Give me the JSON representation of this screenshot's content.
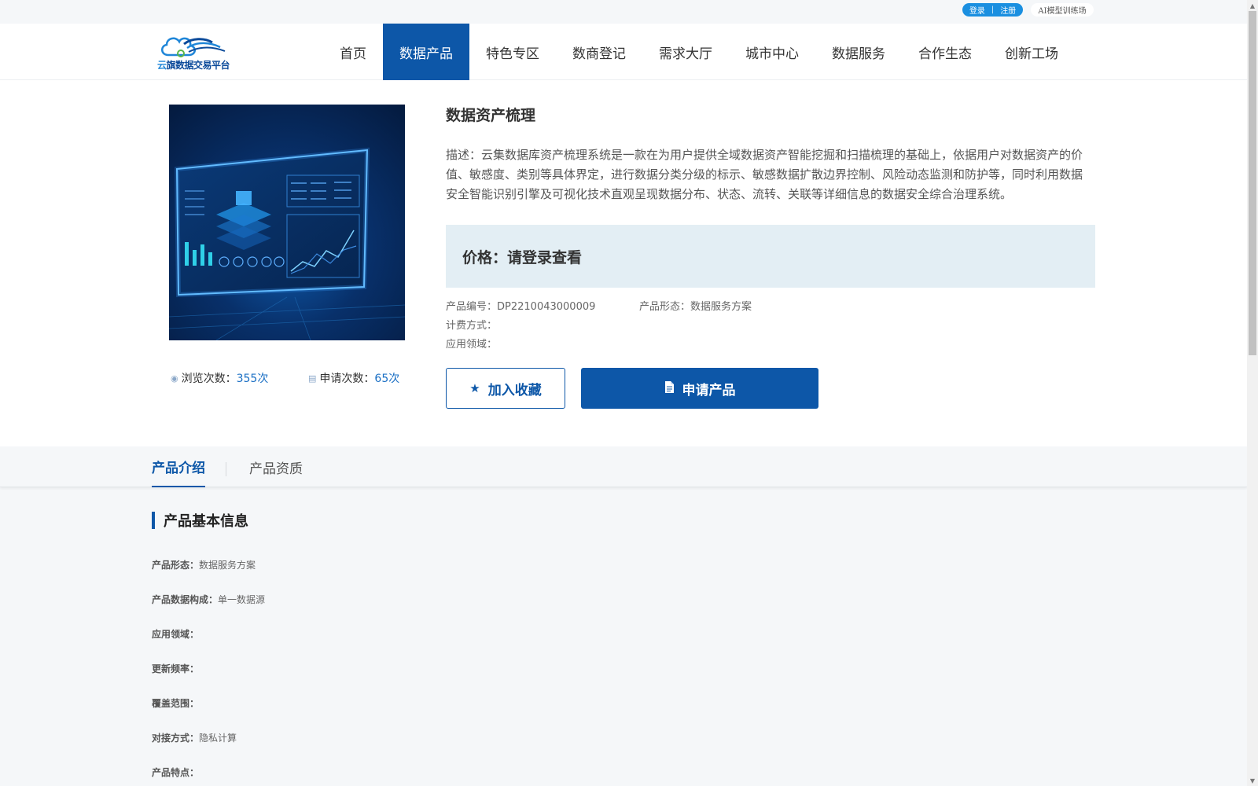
{
  "topbar": {
    "login": "登录",
    "separator": "|",
    "register": "注册",
    "ai_training": "AI模型训练场"
  },
  "logo": {
    "text_prefix": "云",
    "text_rest": "旗数据交易平台"
  },
  "nav": {
    "items": [
      "首页",
      "数据产品",
      "特色专区",
      "数商登记",
      "需求大厅",
      "城市中心",
      "数据服务",
      "合作生态",
      "创新工场"
    ],
    "active_index": 1
  },
  "product": {
    "title": "数据资产梳理",
    "description": "描述：云集数据库资产梳理系统是一款在为用户提供全域数据资产智能挖掘和扫描梳理的基础上，依据用户对数据资产的价值、敏感度、类别等具体界定，进行数据分类分级的标示、敏感数据扩散边界控制、风险动态监测和防护等，同时利用数据安全智能识别引擎及可视化技术直观呈现数据分布、状态、流转、关联等详细信息的数据安全综合治理系统。",
    "price_label": "价格：请登录查看",
    "code_label": "产品编号：",
    "code_value": "DP2210043000009",
    "form_label": "产品形态：",
    "form_value": "数据服务方案",
    "billing_label": "计费方式：",
    "billing_value": "",
    "domain_label": "应用领域：",
    "domain_value": "",
    "views_label": "浏览次数：",
    "views_value": "355次",
    "applies_label": "申请次数：",
    "applies_value": "65次",
    "favorite_button": "加入收藏",
    "apply_button": "申请产品"
  },
  "tabs": {
    "intro": "产品介绍",
    "qualification": "产品资质"
  },
  "basic_info": {
    "title": "产品基本信息",
    "rows": [
      {
        "key": "产品形态：",
        "value": "数据服务方案"
      },
      {
        "key": "产品数据构成：",
        "value": "单一数据源"
      },
      {
        "key": "应用领域：",
        "value": ""
      },
      {
        "key": "更新频率：",
        "value": ""
      },
      {
        "key": "覆盖范围：",
        "value": ""
      },
      {
        "key": "对接方式：",
        "value": "隐私计算"
      },
      {
        "key": "产品特点：",
        "value": ""
      }
    ]
  },
  "colors": {
    "primary": "#0d57a8",
    "link": "#1a6fc4",
    "price_bg": "#e3eef4",
    "page_bg": "#f5f7f9"
  },
  "icons": {
    "views": "eye-icon",
    "applies": "form-icon",
    "favorite": "star-icon",
    "apply": "document-icon"
  }
}
